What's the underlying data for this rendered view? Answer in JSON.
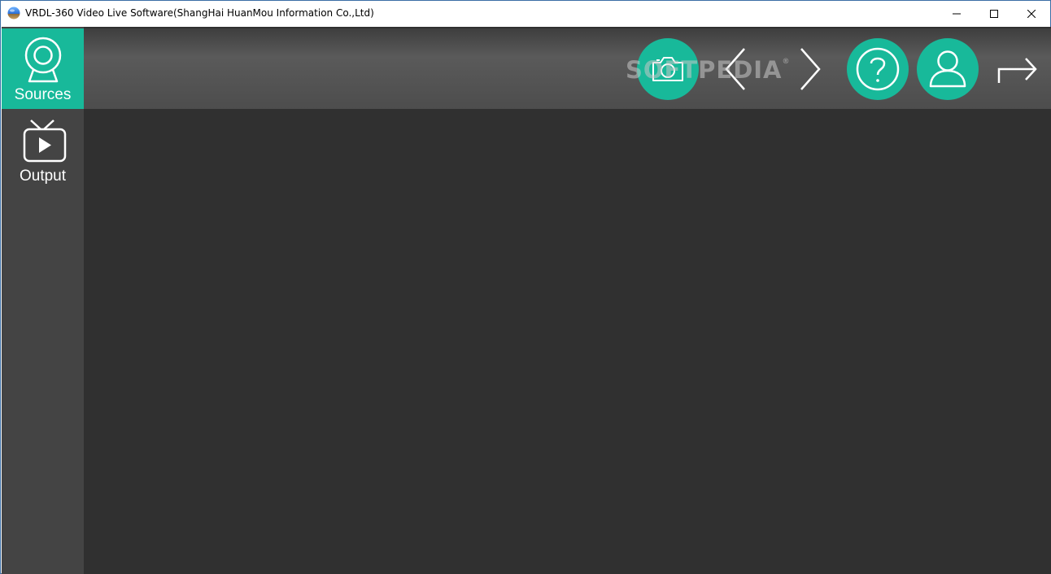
{
  "window": {
    "title": "VRDL-360 Video Live Software(ShangHai HuanMou Information Co.,Ltd)",
    "controls": {
      "minimize": "minimize-icon",
      "maximize": "maximize-icon",
      "close": "close-icon"
    }
  },
  "sidebar": {
    "items": [
      {
        "label": "Sources",
        "icon": "webcam-icon",
        "active": true
      },
      {
        "label": "Output",
        "icon": "tv-play-icon",
        "active": false
      }
    ]
  },
  "toolbar": {
    "buttons": [
      {
        "icon": "camera-icon"
      },
      {
        "icon": "chevron-left-icon"
      },
      {
        "icon": "chevron-right-icon"
      },
      {
        "icon": "help-icon"
      },
      {
        "icon": "user-icon"
      },
      {
        "icon": "exit-arrow-icon"
      }
    ]
  },
  "watermark": {
    "text": "SOFTPEDIA",
    "mark": "®"
  },
  "colors": {
    "accent": "#18b99a",
    "sidebar": "#444444",
    "content": "#303030",
    "toolbar": "#555555"
  }
}
